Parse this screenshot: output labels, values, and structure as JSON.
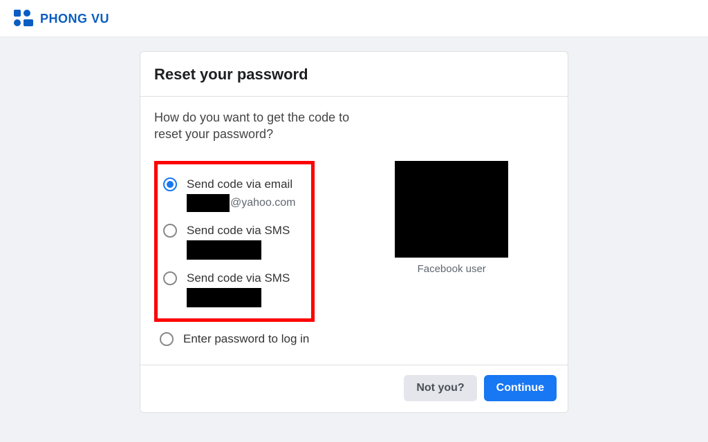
{
  "brand": {
    "name": "PHONG VU"
  },
  "card": {
    "title": "Reset your password",
    "prompt": "How do you want to get the code to reset your password?",
    "options": {
      "email": {
        "label": "Send code via email",
        "suffix": "@yahoo.com"
      },
      "sms1": {
        "label": "Send code via SMS"
      },
      "sms2": {
        "label": "Send code via SMS"
      },
      "pw": {
        "label": "Enter password to log in"
      }
    },
    "profile": {
      "name": "Facebook user"
    },
    "footer": {
      "not_you": "Not you?",
      "continue": "Continue"
    }
  }
}
